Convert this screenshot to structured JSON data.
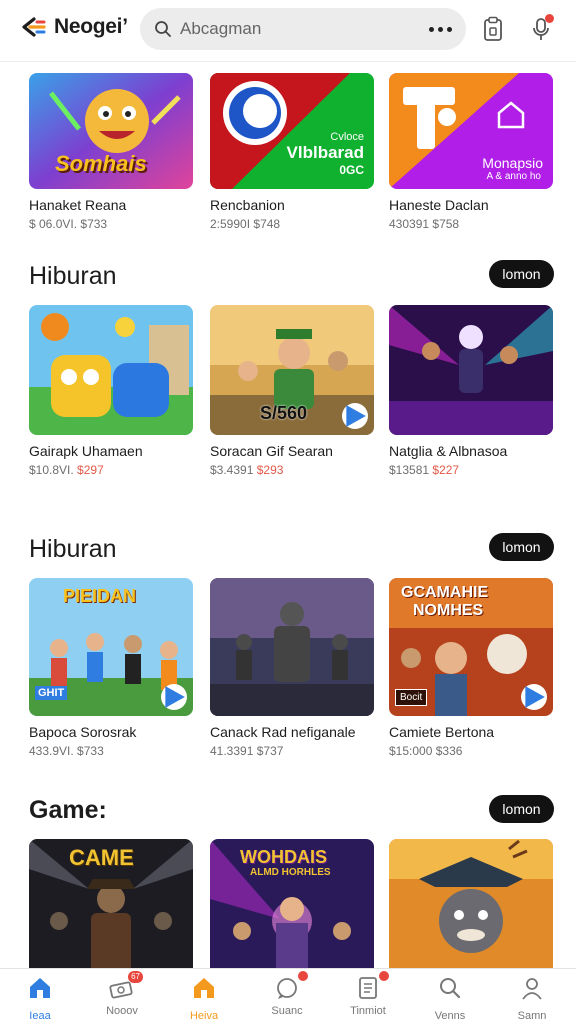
{
  "app": {
    "name": "Neogei’"
  },
  "search": {
    "placeholder": "Abcagman"
  },
  "sections": [
    {
      "title": "",
      "cards": [
        {
          "title": "Hanaket Reana",
          "meta_a": "$ 06.0VI.",
          "meta_b": "$733",
          "art_text": "Somhais"
        },
        {
          "title": "Rencbanion",
          "meta_a": "2:5990I",
          "meta_b": "$748",
          "art_text_1": "Cvloce",
          "art_text_2": "Vlblbarad",
          "art_text_3": "0GC"
        },
        {
          "title": "Haneste Daclan",
          "meta_a": "430391",
          "meta_b": "$758",
          "art_text_1": "Monapsio",
          "art_text_2": "A & anno ho"
        }
      ]
    },
    {
      "title": "Hiburan",
      "pill": "lomon",
      "cards": [
        {
          "title": "Gairapk Uhamaen",
          "meta_a": "$10.8VI.",
          "meta_b": "$297"
        },
        {
          "title": "Soracan Gif Searan",
          "meta_a": "$3.4391",
          "meta_b": "$293",
          "art_text": "S/560"
        },
        {
          "title": "Natglia & Albnasoa",
          "meta_a": "$13581",
          "meta_b": "$227"
        }
      ]
    },
    {
      "title": "Hiburan",
      "pill": "lomon",
      "cards": [
        {
          "title": "Bapoca Sorosrak",
          "meta_a": "433.9VI.",
          "meta_b": "$733",
          "art_text_1": "PIEIDAN",
          "art_text_2": "GHIT"
        },
        {
          "title": "Canack Rad nefiganale",
          "meta_a": "41.3391",
          "meta_b": "$737"
        },
        {
          "title": "Camiete Bertona",
          "meta_a": "$15:000",
          "meta_b": "$336",
          "art_text_1": "GCAMAHIE",
          "art_text_2": "NOMHES",
          "art_text_3": "Bocit"
        }
      ]
    },
    {
      "title": "Game:",
      "pill": "lomon",
      "cards": [
        {
          "art_text": "CAME"
        },
        {
          "art_text_1": "WOHDAIS",
          "art_text_2": "ALMD HORHLES"
        },
        {}
      ]
    }
  ],
  "bottom_nav": [
    {
      "label": "Ieaa",
      "icon": "home-icon",
      "state": "active"
    },
    {
      "label": "Nooov",
      "icon": "cash-icon",
      "badge": "67"
    },
    {
      "label": "Heiva",
      "icon": "home-icon",
      "state": "hot"
    },
    {
      "label": "Suanc",
      "icon": "chat-icon",
      "badge": ""
    },
    {
      "label": "Tinmiot",
      "icon": "document-icon",
      "badge": ""
    },
    {
      "label": "Venns",
      "icon": "search-icon"
    },
    {
      "label": "Samn",
      "icon": "profile-icon"
    }
  ],
  "colors": {
    "accent_blue": "#2f7de1",
    "accent_orange": "#f39a1e",
    "badge_red": "#e8463c"
  }
}
